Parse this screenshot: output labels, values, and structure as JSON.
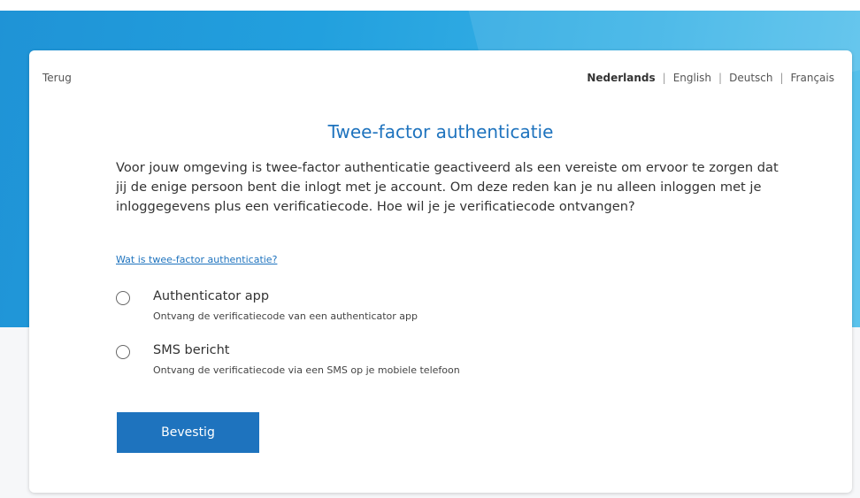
{
  "header": {
    "back_label": "Terug",
    "languages": [
      {
        "label": "Nederlands",
        "active": true
      },
      {
        "label": "English",
        "active": false
      },
      {
        "label": "Deutsch",
        "active": false
      },
      {
        "label": "Français",
        "active": false
      }
    ],
    "separator": "|"
  },
  "main": {
    "title": "Twee-factor authenticatie",
    "intro": "Voor jouw omgeving is twee-factor authenticatie geactiveerd als een vereiste om ervoor te zorgen dat jij de enige persoon bent die inlogt met je account. Om deze reden kan je nu alleen inloggen met je inloggegevens plus een verificatiecode. Hoe wil je je verificatiecode ontvangen?",
    "help_link": "Wat is twee-factor authenticatie?",
    "options": [
      {
        "label": "Authenticator app",
        "description": "Ontvang de verificatiecode van een authenticator app",
        "selected": false
      },
      {
        "label": "SMS bericht",
        "description": "Ontvang de verificatiecode via een SMS op je mobiele telefoon",
        "selected": false
      }
    ],
    "confirm_label": "Bevestig"
  },
  "colors": {
    "accent": "#1e73be",
    "banner": "#22a0de",
    "background": "#f6f7f9"
  }
}
